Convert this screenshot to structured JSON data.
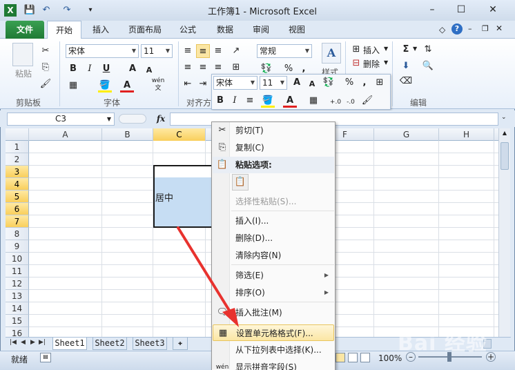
{
  "window": {
    "title": "工作簿1 - Microsoft Excel",
    "controls": {
      "minimize": "–",
      "maximize": "☐",
      "close": "✕"
    }
  },
  "quick_access": {
    "save": "💾",
    "undo": "↶",
    "redo": "↷",
    "customize": "▾"
  },
  "tabs": [
    {
      "label": "文件"
    },
    {
      "label": "开始"
    },
    {
      "label": "插入"
    },
    {
      "label": "页面布局"
    },
    {
      "label": "公式"
    },
    {
      "label": "数据"
    },
    {
      "label": "审阅"
    },
    {
      "label": "视图"
    }
  ],
  "ribbon": {
    "clipboard": {
      "paste_label": "粘贴",
      "group_label": "剪贴板"
    },
    "font": {
      "name": "宋体",
      "size": "11",
      "group_label": "字体",
      "bold": "B",
      "italic": "I",
      "underline": "U",
      "grow": "A",
      "shrink": "A",
      "font_color": "A",
      "phonetic": "wén 文"
    },
    "alignment": {
      "group_label": "对齐方"
    },
    "number": {
      "format": "常规",
      "percent": "%",
      "comma": ","
    },
    "styles": {
      "label": "样式"
    },
    "cells": {
      "insert": "插入",
      "delete": "删除"
    },
    "editing": {
      "group_label": "编辑",
      "sum": "Σ"
    }
  },
  "formula_bar": {
    "name_box": "C3",
    "fx": "fx",
    "value": ""
  },
  "columns": [
    "A",
    "B",
    "C",
    "D",
    "E",
    "F",
    "G",
    "H",
    "I"
  ],
  "rows": [
    "1",
    "2",
    "3",
    "4",
    "5",
    "6",
    "7",
    "8",
    "9",
    "10",
    "11",
    "12",
    "13",
    "14",
    "15",
    "16"
  ],
  "selected_column": "C",
  "selected_rows": [
    "3",
    "4",
    "5",
    "6",
    "7"
  ],
  "cell_text": "居中",
  "sheets": [
    "Sheet1",
    "Sheet2",
    "Sheet3"
  ],
  "status": {
    "mode": "就绪",
    "zoom": "100%"
  },
  "mini_toolbar": {
    "font": "宋体",
    "size": "11",
    "bold": "B",
    "italic": "I",
    "align": "≡",
    "percent": "%",
    "comma": ",",
    "dec_inc": "+.0",
    "dec_dec": "-.0"
  },
  "context_menu": [
    {
      "label": "剪切(T)",
      "icon": "scissors-icon",
      "glyph": "✂"
    },
    {
      "label": "复制(C)",
      "icon": "copy-icon",
      "glyph": "⎘"
    },
    {
      "label": "粘贴选项:",
      "icon": "paste-icon",
      "glyph": "📋",
      "header": true
    },
    {
      "label": "选择性粘贴(S)...",
      "disabled": true
    },
    {
      "label": "插入(I)..."
    },
    {
      "label": "删除(D)..."
    },
    {
      "label": "清除内容(N)"
    },
    {
      "label": "筛选(E)",
      "submenu": true
    },
    {
      "label": "排序(O)",
      "submenu": true
    },
    {
      "label": "插入批注(M)",
      "icon": "comment-icon",
      "glyph": "🗨"
    },
    {
      "label": "设置单元格格式(F)...",
      "icon": "format-cells-icon",
      "glyph": "▦",
      "highlighted": true
    },
    {
      "label": "从下拉列表中选择(K)..."
    },
    {
      "label": "显示拼音字段(S)",
      "icon": "phonetic-icon",
      "glyph": "wén"
    }
  ],
  "watermark": "Bai 经验",
  "colors": {
    "file_tab": "#2a8a43",
    "selection": "#c6ddf3",
    "header_highlight": "#f9cf5c",
    "arrow": "#e8322e"
  }
}
